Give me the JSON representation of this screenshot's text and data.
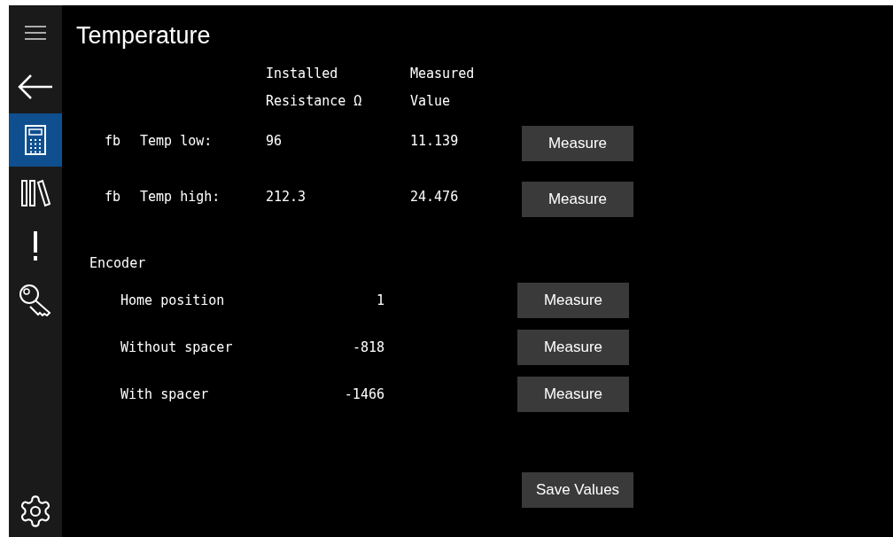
{
  "sidebar": {
    "items": [
      {
        "kind": "back",
        "selected": false
      },
      {
        "kind": "calculator",
        "selected": true
      },
      {
        "kind": "library",
        "selected": false
      },
      {
        "kind": "alert",
        "selected": false
      },
      {
        "kind": "key",
        "selected": false
      }
    ]
  },
  "title": "Temperature",
  "temperature": {
    "columns": [
      {
        "line_1": "Installed",
        "line_2": "Resistance Ω"
      },
      {
        "line_1": "Measured",
        "line_2": "Value"
      }
    ],
    "rows": [
      {
        "prefix": "fb",
        "label": "Temp low:",
        "installed": "96",
        "measured": "11.139",
        "button": "Measure"
      },
      {
        "prefix": "fb",
        "label": "Temp high:",
        "installed": "212.3",
        "measured": "24.476",
        "button": "Measure"
      }
    ]
  },
  "encoder": {
    "title": "Encoder",
    "rows": [
      {
        "label": "Home position",
        "value": "1",
        "button": "Measure"
      },
      {
        "label": "Without spacer",
        "value": "-818",
        "button": "Measure"
      },
      {
        "label": "With spacer",
        "value": "-1466",
        "button": "Measure"
      }
    ]
  },
  "save_button": "Save Values"
}
